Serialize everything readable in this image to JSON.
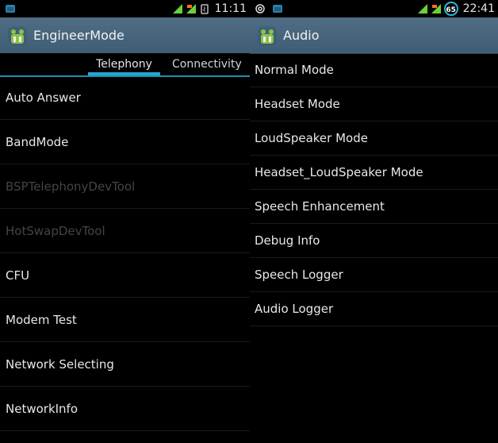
{
  "left": {
    "status": {
      "time": "11:11",
      "left_icons": [
        "android-icon"
      ],
      "right_icons": [
        "signal-icon",
        "data-icon",
        "charging-icon"
      ]
    },
    "actionbar": {
      "title": "EngineerMode",
      "icon": "android-icon"
    },
    "tabs": [
      {
        "label": "Telephony",
        "selected": true
      },
      {
        "label": "Connectivity",
        "selected": false
      }
    ],
    "items": [
      {
        "label": "Auto Answer",
        "enabled": true
      },
      {
        "label": "BandMode",
        "enabled": true
      },
      {
        "label": "BSPTelephonyDevTool",
        "enabled": false
      },
      {
        "label": "HotSwapDevTool",
        "enabled": false
      },
      {
        "label": "CFU",
        "enabled": true
      },
      {
        "label": "Modem Test",
        "enabled": true
      },
      {
        "label": "Network Selecting",
        "enabled": true
      },
      {
        "label": "NetworkInfo",
        "enabled": true
      }
    ]
  },
  "right": {
    "status": {
      "time": "22:41",
      "battery": "65",
      "left_icons": [
        "at-icon",
        "android-icon"
      ],
      "right_icons": [
        "signal-icon",
        "data-icon"
      ]
    },
    "actionbar": {
      "title": "Audio",
      "icon": "android-icon"
    },
    "items": [
      {
        "label": "Normal Mode"
      },
      {
        "label": "Headset Mode"
      },
      {
        "label": "LoudSpeaker Mode"
      },
      {
        "label": "Headset_LoudSpeaker Mode"
      },
      {
        "label": "Speech Enhancement"
      },
      {
        "label": "Debug Info"
      },
      {
        "label": "Speech Logger"
      },
      {
        "label": "Audio Logger"
      }
    ]
  },
  "colors": {
    "actionbar": "#4a6880",
    "tab_indicator": "#27a6cf",
    "text": "#e8e8e8",
    "disabled_text": "#444444"
  }
}
